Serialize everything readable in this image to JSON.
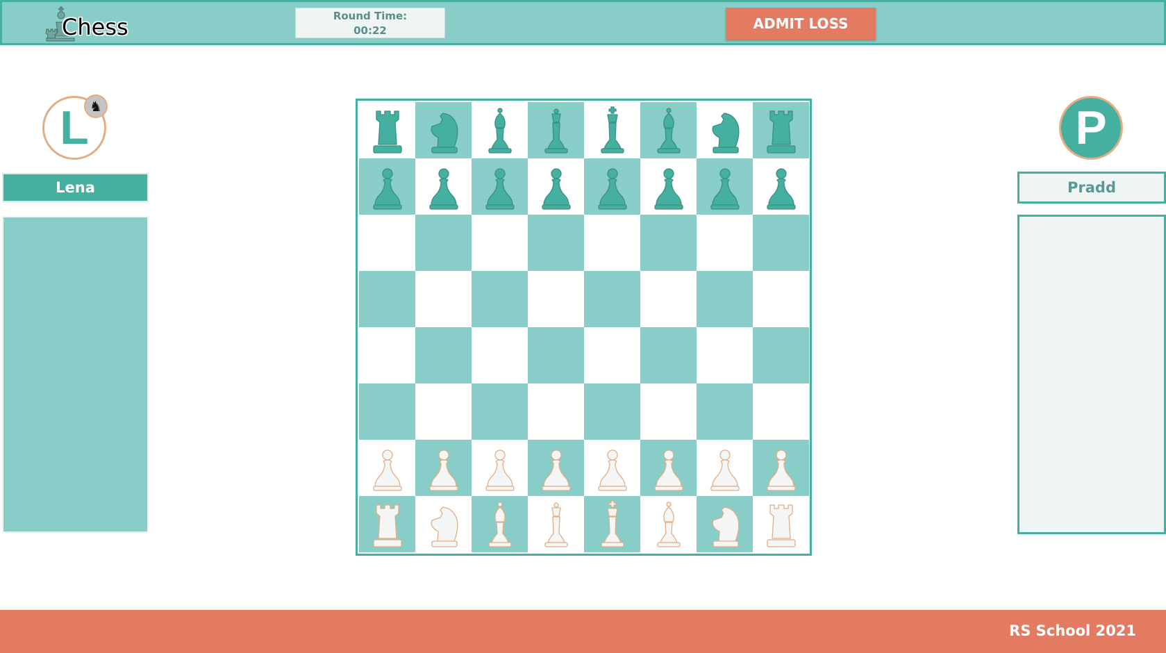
{
  "header": {
    "app_title": "Chess",
    "logo_icon": "chess-pieces-icon",
    "round_time_label": "Round Time:",
    "round_time_value": "00:22",
    "admit_loss_label": "ADMIT LOSS"
  },
  "players": {
    "left": {
      "initial": "L",
      "name": "Lena",
      "badge_icon": "knight-turn-icon"
    },
    "right": {
      "initial": "P",
      "name": "Pradd"
    }
  },
  "board": {
    "ranks": [
      [
        "bR",
        "bN",
        "bB",
        "bQ",
        "bK",
        "bB",
        "bN",
        "bR"
      ],
      [
        "bP",
        "bP",
        "bP",
        "bP",
        "bP",
        "bP",
        "bP",
        "bP"
      ],
      [
        "",
        "",
        "",
        "",
        "",
        "",
        "",
        ""
      ],
      [
        "",
        "",
        "",
        "",
        "",
        "",
        "",
        ""
      ],
      [
        "",
        "",
        "",
        "",
        "",
        "",
        "",
        ""
      ],
      [
        "",
        "",
        "",
        "",
        "",
        "",
        "",
        ""
      ],
      [
        "wP",
        "wP",
        "wP",
        "wP",
        "wP",
        "wP",
        "wP",
        "wP"
      ],
      [
        "wR",
        "wN",
        "wB",
        "wQ",
        "wK",
        "wB",
        "wN",
        "wR"
      ]
    ]
  },
  "colors": {
    "teal": "#45b0a0",
    "light_teal": "#88cdc8",
    "coral": "#e37b63",
    "peach_outline": "#e3ad84",
    "white_piece_fill": "#f4f6f5"
  },
  "footer": {
    "text": "RS School 2021"
  }
}
